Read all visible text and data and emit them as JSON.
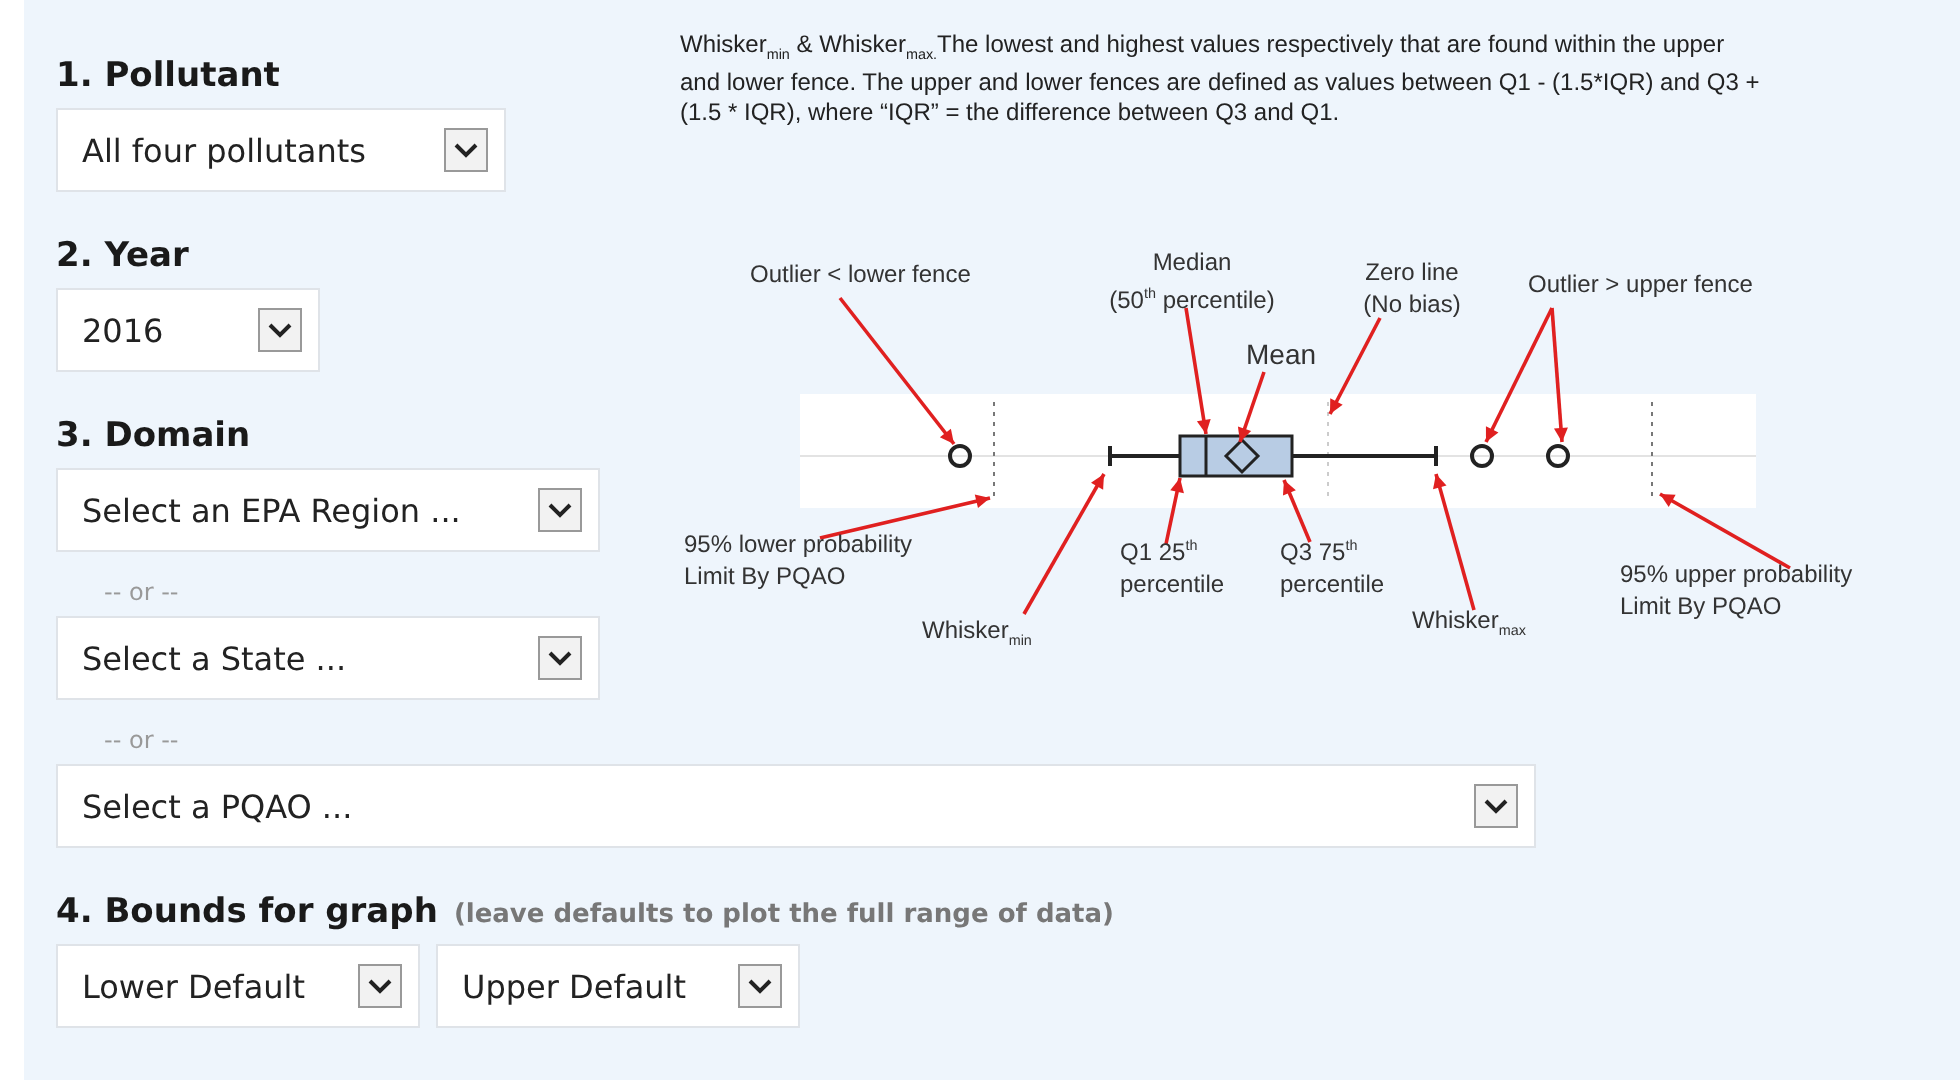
{
  "steps": [
    {
      "heading": "1. Pollutant",
      "controls": [
        {
          "kind": "select",
          "value": "All four pollutants"
        }
      ]
    },
    {
      "heading": "2. Year",
      "controls": [
        {
          "kind": "select",
          "value": "2016"
        }
      ]
    },
    {
      "heading": "3. Domain",
      "controls": [
        {
          "kind": "select",
          "value": "Select an EPA Region ..."
        },
        {
          "kind": "separator",
          "text": "-- or --"
        },
        {
          "kind": "select",
          "value": "Select a State ..."
        },
        {
          "kind": "separator",
          "text": "-- or --"
        },
        {
          "kind": "select",
          "value": "Select a PQAO ..."
        }
      ]
    },
    {
      "heading": "4. Bounds for graph",
      "hint": "(leave defaults to plot the full range of data)",
      "controls": [
        {
          "kind": "select",
          "value": "Lower Default"
        },
        {
          "kind": "select",
          "value": "Upper Default"
        }
      ]
    }
  ],
  "legend": {
    "note": "Whisker$_{min}$  & Whisker$_{max.}$The lowest and highest values respectively that are found within the upper and lower fence.  The upper and lower fences are defined as values between Q1 - (1.5*IQR) and Q3 + (1.5 * IQR), where “IQR” = the difference between Q3 and Q1.",
    "callouts": [
      {
        "text": "Outlier < lower fence"
      },
      {
        "text": "Median\n(50$^{th}$ percentile)"
      },
      {
        "text": "Zero line\n(No bias)"
      },
      {
        "text": "Outlier > upper fence"
      },
      {
        "text": "Mean"
      },
      {
        "text": "95% lower probability\nLimit By PQAO"
      },
      {
        "text": "Whisker$_{min}$"
      },
      {
        "text": "Q1 25$^{th}$\npercentile"
      },
      {
        "text": "Q3 75$^{th}$\npercentile"
      },
      {
        "text": "Whisker$_{max}$"
      },
      {
        "text": "95%  upper probability\nLimit By PQAO"
      }
    ]
  }
}
